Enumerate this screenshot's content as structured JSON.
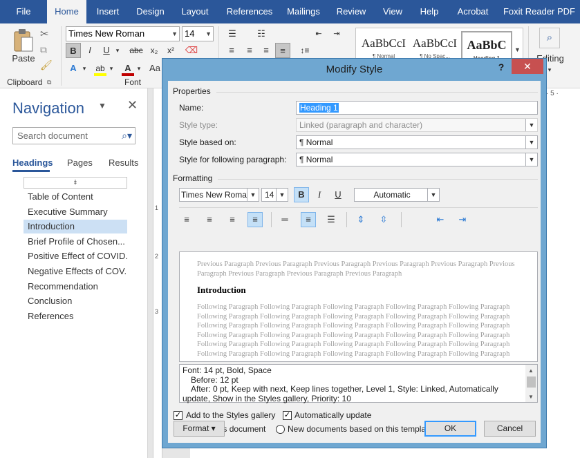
{
  "ribbon": {
    "tabs": [
      "File",
      "Home",
      "Insert",
      "Design",
      "Layout",
      "References",
      "Mailings",
      "Review",
      "View",
      "Help",
      "Acrobat",
      "Foxit Reader PDF"
    ],
    "active_tab": "Home",
    "clipboard": {
      "paste_label": "Paste",
      "group_label": "Clipboard"
    },
    "font": {
      "name": "Times New Roman",
      "size": "14",
      "group_label": "Font",
      "grow_label": "Aa",
      "font_color": "#c00000",
      "highlight_color": "#ffff00"
    },
    "editing_label": "Editing",
    "styles_gallery": [
      {
        "sample": "AaBbCcI",
        "name": "¶ Normal"
      },
      {
        "sample": "AaBbCcI",
        "name": "¶ No Spac..."
      },
      {
        "sample": "AaBbC",
        "name": "Heading 1"
      }
    ]
  },
  "navigation": {
    "title": "Navigation",
    "search_placeholder": "Search document",
    "tabs": [
      "Headings",
      "Pages",
      "Results"
    ],
    "active_tab": "Headings",
    "headings": [
      "Table of Content",
      "Executive Summary",
      "Introduction",
      "Brief Profile of Chosen...",
      "Positive Effect of COVID...",
      "Negative Effects of COV...",
      "Recommendation",
      "Conclusion",
      "References"
    ],
    "selected_heading": "Introduction"
  },
  "ruler": {
    "h_mark": "· 5 ·",
    "v_marks": [
      "1",
      "2",
      "3"
    ]
  },
  "dialog": {
    "title": "Modify Style",
    "help": "?",
    "close": "✕",
    "properties": {
      "section": "Properties",
      "name_label": "Name:",
      "name_value": "Heading 1",
      "type_label": "Style type:",
      "type_value": "Linked (paragraph and character)",
      "based_label": "Style based on:",
      "based_value": "¶  Normal",
      "following_label": "Style for following paragraph:",
      "following_value": "¶  Normal"
    },
    "formatting": {
      "section": "Formatting",
      "font": "Times New Roman",
      "size": "14",
      "bold": "B",
      "italic": "I",
      "underline": "U",
      "color": "Automatic"
    },
    "preview": {
      "previous": "Previous Paragraph Previous Paragraph Previous Paragraph Previous Paragraph Previous Paragraph Previous Paragraph Previous Paragraph Previous Paragraph Previous Paragraph",
      "heading": "Introduction",
      "following": "Following Paragraph Following Paragraph Following Paragraph Following Paragraph Following Paragraph Following Paragraph Following Paragraph Following Paragraph Following Paragraph Following Paragraph Following Paragraph Following Paragraph Following Paragraph Following Paragraph Following Paragraph Following Paragraph Following Paragraph Following Paragraph Following Paragraph Following Paragraph Following Paragraph Following Paragraph Following Paragraph Following Paragraph Following Paragraph Following Paragraph Following Paragraph Following Paragraph Following Paragraph Following Paragraph Following Paragraph Following Paragraph Following Paragraph Following Paragraph Following Paragraph Following Paragraph"
    },
    "description": {
      "line1": "Font: 14 pt, Bold, Space",
      "line2": "Before:  12 pt",
      "line3": "After:  0 pt, Keep with next, Keep lines together, Level 1, Style: Linked, Automatically",
      "line4": "update, Show in the Styles gallery, Priority: 10"
    },
    "options": {
      "add_gallery": "Add to the Styles gallery",
      "auto_update": "Automatically update",
      "only_doc": "Only in this document",
      "new_docs": "New documents based on this template"
    },
    "buttons": {
      "format": "Format ▾",
      "ok": "OK",
      "cancel": "Cancel"
    }
  }
}
